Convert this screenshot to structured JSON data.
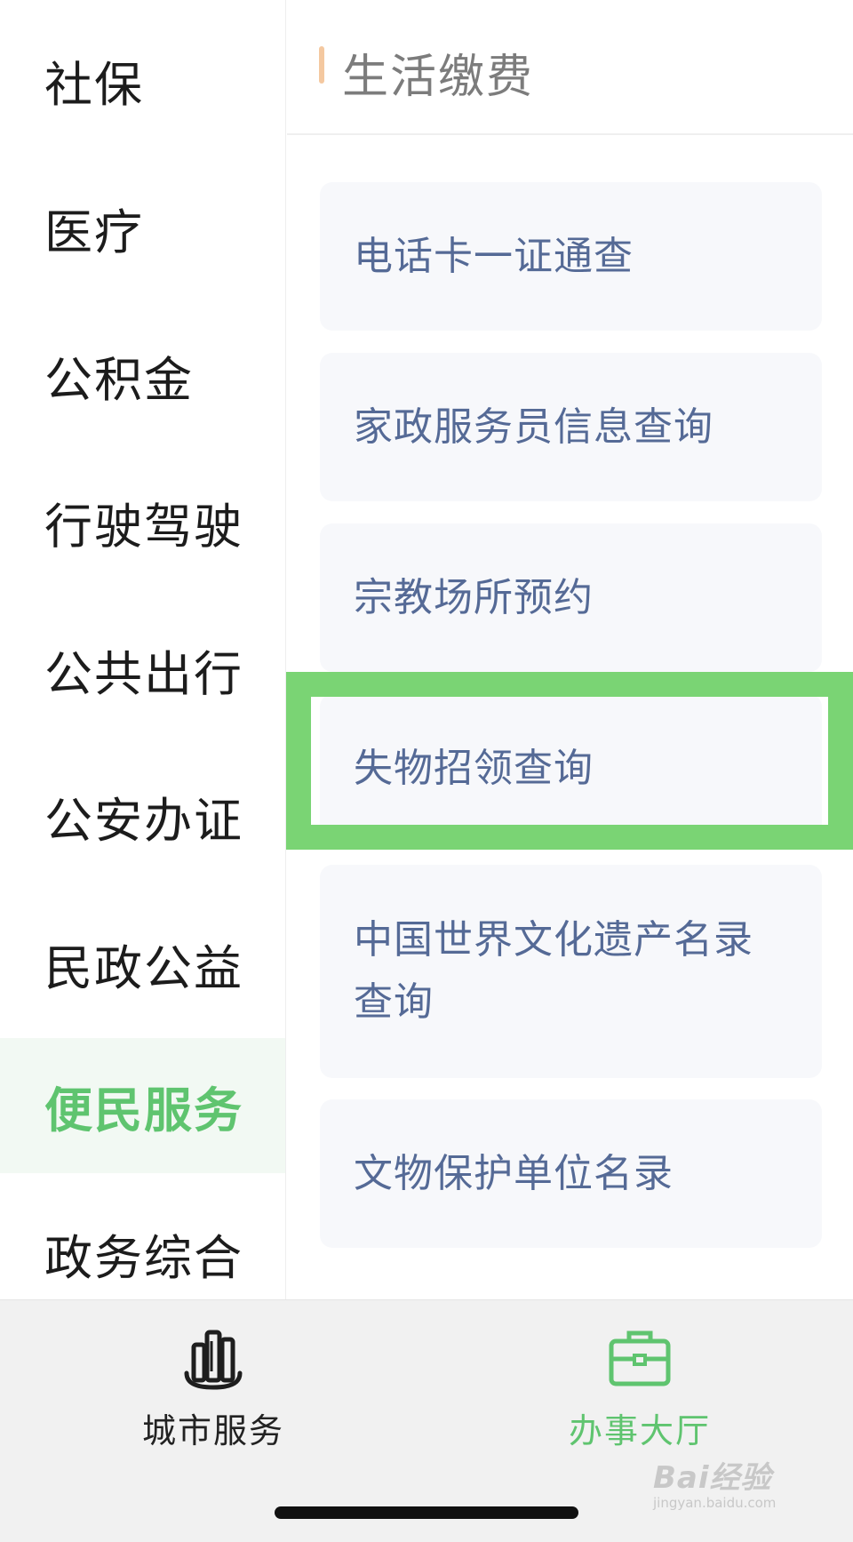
{
  "sidebar": {
    "items": [
      {
        "label": "社保",
        "active": false
      },
      {
        "label": "医疗",
        "active": false
      },
      {
        "label": "公积金",
        "active": false
      },
      {
        "label": "行驶驾驶",
        "active": false
      },
      {
        "label": "公共出行",
        "active": false
      },
      {
        "label": "公安办证",
        "active": false
      },
      {
        "label": "民政公益",
        "active": false
      },
      {
        "label": "便民服务",
        "active": true
      },
      {
        "label": "政务综合",
        "active": false
      }
    ]
  },
  "section": {
    "title": "生活缴费",
    "accent_color": "#f4c8a0"
  },
  "services": [
    {
      "label": "电话卡一证通查"
    },
    {
      "label": "家政服务员信息查询"
    },
    {
      "label": "宗教场所预约"
    },
    {
      "label": "失物招领查询",
      "highlighted": true
    },
    {
      "label": "中国世界文化遗产名录查询"
    },
    {
      "label": "文物保护单位名录"
    }
  ],
  "tabbar": {
    "city": {
      "label": "城市服务",
      "icon": "city-buildings-icon"
    },
    "hall": {
      "label": "办事大厅",
      "icon": "briefcase-icon",
      "active": true
    }
  },
  "watermark": {
    "main": "Bai经验",
    "sub": "jingyan.baidu.com"
  },
  "colors": {
    "active_green": "#5fc46f",
    "highlight_green": "#7ad474",
    "card_bg": "#f7f8fb",
    "card_text": "#556a96"
  }
}
